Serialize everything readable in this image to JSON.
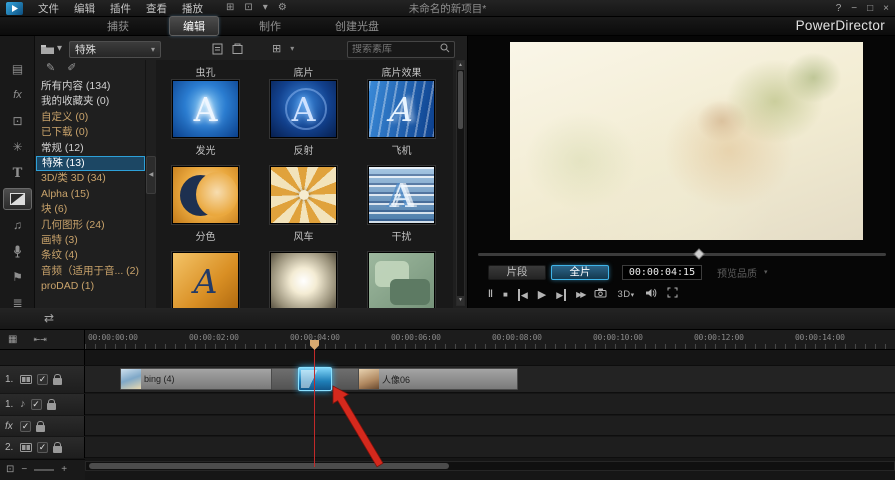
{
  "colors": {
    "accent": "#2da0d8",
    "selection": "#1c4764",
    "annotation_arrow": "#d5291d"
  },
  "menubar": {
    "menus": [
      "文件",
      "编辑",
      "插件",
      "查看",
      "播放"
    ],
    "title": "未命名的新项目*"
  },
  "tabbar": {
    "tabs": [
      "捕获",
      "编辑",
      "制作",
      "创建光盘"
    ],
    "brand": "PowerDirector"
  },
  "library": {
    "toolbar": {
      "filter": "特殊",
      "search_placeholder": "搜索素库"
    },
    "categories": [
      "所有内容 (134)",
      "我的收藏夹 (0)",
      "自定义 (0)",
      "已下载 (0)",
      "常规 (12)",
      "特殊 (13)",
      "3D/类 3D (34)",
      "Alpha (15)",
      "块 (6)",
      "几何图形 (24)",
      "画特 (3)",
      "条纹 (4)",
      "音频（适用于音... (2)",
      "proDAD (1)"
    ],
    "grid": {
      "top_labels": [
        "虫孔",
        "底片",
        "底片效果"
      ],
      "row1": [
        "发光",
        "反射",
        "飞机"
      ],
      "row2": [
        "分色",
        "风车",
        "干扰"
      ]
    }
  },
  "preview": {
    "clip_button": "片段",
    "movie_button": "全片",
    "timecode": "00:00:04:15",
    "quality_label": "预览品质"
  },
  "timeline": {
    "ruler": [
      "00:00:00:00",
      "00:00:02:00",
      "00:00:04:00",
      "00:00:06:00",
      "00:00:08:00",
      "00:00:10:00",
      "00:00:12:00",
      "00:00:14:00"
    ],
    "tracks": [
      {
        "label": "1.",
        "clips": [
          "bing (4)",
          "人像06"
        ]
      },
      {
        "label": "1."
      },
      {
        "label": "fx"
      },
      {
        "label": "2."
      }
    ]
  },
  "icons": {
    "layout": "⊞",
    "monitor": "⊡",
    "caret": "▾",
    "gear": "⚙",
    "help": "?",
    "minimize": "−",
    "maximize": "□",
    "close": "×",
    "room_media": "▤",
    "room_effect": "fx",
    "room_pip": "⊡",
    "room_particle": "✳",
    "room_title": "T",
    "room_mixer": "♫",
    "room_chapter": "⚑",
    "room_subtitle": "≣",
    "pen_a": "✎",
    "pen_b": "✐",
    "collapse_left": "◀",
    "pause": "‖",
    "stop": "■",
    "prev": "◀",
    "play": "▶",
    "next": "▶",
    "ff": "▶▶",
    "threed": "3D",
    "ruler_menu": "▦",
    "ruler_collapse": "⇤⇥",
    "audio_note": "♪",
    "check": "✓",
    "track_manager": "⇄",
    "minus": "−",
    "plus": "+",
    "up": "▲",
    "down": "▼"
  }
}
